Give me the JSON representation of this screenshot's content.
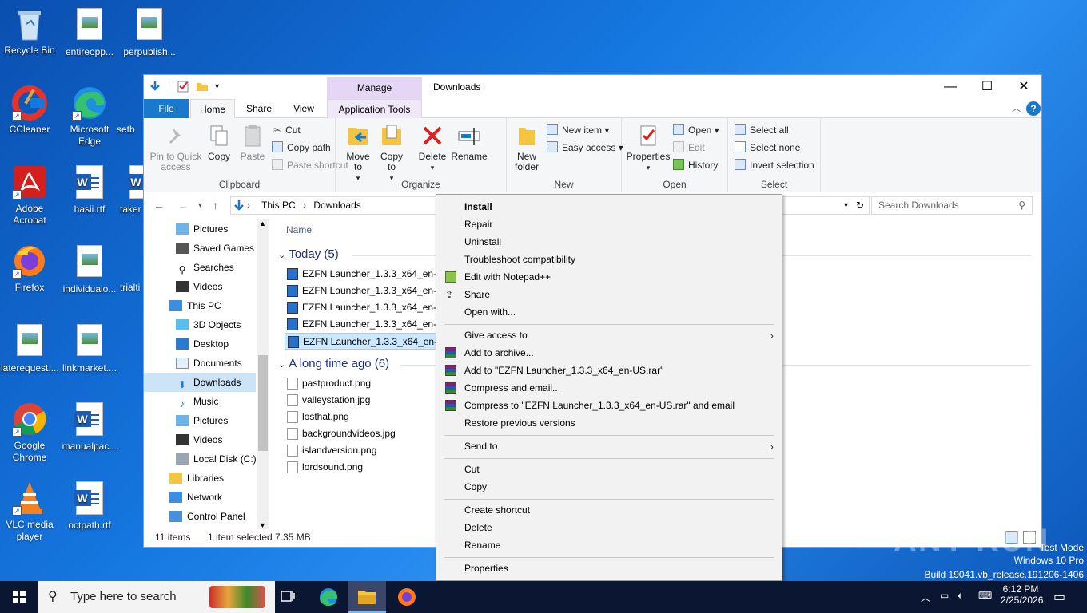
{
  "desktop_icons": [
    {
      "label": "Recycle Bin"
    },
    {
      "label": "entireopp..."
    },
    {
      "label": "perpublish..."
    },
    {
      "label": "CCleaner"
    },
    {
      "label": "Microsoft Edge"
    },
    {
      "label": "setb"
    },
    {
      "label": "Adobe Acrobat"
    },
    {
      "label": "hasii.rtf"
    },
    {
      "label": "taker"
    },
    {
      "label": "Firefox"
    },
    {
      "label": "individualo..."
    },
    {
      "label": "trialti"
    },
    {
      "label": "laterequest...."
    },
    {
      "label": "linkmarket...."
    },
    {
      "label": "Google Chrome"
    },
    {
      "label": "manualpac..."
    },
    {
      "label": "VLC media player"
    },
    {
      "label": "octpath.rtf"
    }
  ],
  "window": {
    "manage_tab": "Manage",
    "title": "Downloads",
    "tabs": {
      "file": "File",
      "home": "Home",
      "share": "Share",
      "view": "View",
      "app_tools": "Application Tools"
    },
    "ribbon": {
      "clipboard": {
        "label": "Clipboard",
        "pin": "Pin to Quick access",
        "copy": "Copy",
        "paste": "Paste",
        "cut": "Cut",
        "copy_path": "Copy path",
        "paste_shortcut": "Paste shortcut"
      },
      "organize": {
        "label": "Organize",
        "move_to": "Move to",
        "copy_to": "Copy to",
        "delete": "Delete",
        "rename": "Rename"
      },
      "new": {
        "label": "New",
        "new_folder": "New folder",
        "new_item": "New item",
        "easy_access": "Easy access"
      },
      "open": {
        "label": "Open",
        "properties": "Properties",
        "open": "Open",
        "edit": "Edit",
        "history": "History"
      },
      "select": {
        "label": "Select",
        "select_all": "Select all",
        "select_none": "Select none",
        "invert": "Invert selection"
      }
    },
    "address": {
      "this_pc": "This PC",
      "downloads": "Downloads"
    },
    "search_placeholder": "Search Downloads",
    "nav_items": [
      {
        "label": "Pictures",
        "indent": 2
      },
      {
        "label": "Saved Games",
        "indent": 2
      },
      {
        "label": "Searches",
        "indent": 2
      },
      {
        "label": "Videos",
        "indent": 2
      },
      {
        "label": "This PC",
        "indent": 1
      },
      {
        "label": "3D Objects",
        "indent": 2
      },
      {
        "label": "Desktop",
        "indent": 2
      },
      {
        "label": "Documents",
        "indent": 2
      },
      {
        "label": "Downloads",
        "indent": 2,
        "selected": true
      },
      {
        "label": "Music",
        "indent": 2
      },
      {
        "label": "Pictures",
        "indent": 2
      },
      {
        "label": "Videos",
        "indent": 2
      },
      {
        "label": "Local Disk (C:)",
        "indent": 2
      },
      {
        "label": "Libraries",
        "indent": 1
      },
      {
        "label": "Network",
        "indent": 1
      },
      {
        "label": "Control Panel",
        "indent": 1
      }
    ],
    "column_name": "Name",
    "group_today": "Today (5)",
    "today_files": [
      "EZFN Launcher_1.3.3_x64_en-US",
      "EZFN Launcher_1.3.3_x64_en-US",
      "EZFN Launcher_1.3.3_x64_en-US",
      "EZFN Launcher_1.3.3_x64_en-US",
      "EZFN Launcher_1.3.3_x64_en-US"
    ],
    "group_old": "A long time ago (6)",
    "old_files": [
      "pastproduct.png",
      "valleystation.jpg",
      "losthat.png",
      "backgroundvideos.jpg",
      "islandversion.png",
      "lordsound.png"
    ],
    "status": {
      "items": "11 items",
      "selected": "1 item selected",
      "size": "7.35 MB"
    }
  },
  "context_menu": {
    "install": "Install",
    "repair": "Repair",
    "uninstall": "Uninstall",
    "troubleshoot": "Troubleshoot compatibility",
    "notepad": "Edit with Notepad++",
    "share": "Share",
    "open_with": "Open with...",
    "give_access": "Give access to",
    "add_archive": "Add to archive...",
    "add_rar": "Add to \"EZFN Launcher_1.3.3_x64_en-US.rar\"",
    "compress_email": "Compress and email...",
    "compress_rar_email": "Compress to \"EZFN Launcher_1.3.3_x64_en-US.rar\" and email",
    "restore": "Restore previous versions",
    "send_to": "Send to",
    "cut": "Cut",
    "copy": "Copy",
    "create_shortcut": "Create shortcut",
    "delete": "Delete",
    "rename": "Rename",
    "properties": "Properties"
  },
  "watermark": {
    "text": "ANY RUN",
    "test_mode": "Test Mode",
    "edition": "Windows 10 Pro",
    "build": "Build 19041.vb_release.191206-1406"
  },
  "taskbar": {
    "search_placeholder": "Type here to search",
    "time": "6:12 PM",
    "date": "2/25/2026"
  },
  "colors": {
    "accent": "#1979ca",
    "manage": "#e6d6f5",
    "selection": "#cce8ff",
    "taskbar": "#0b1633"
  }
}
